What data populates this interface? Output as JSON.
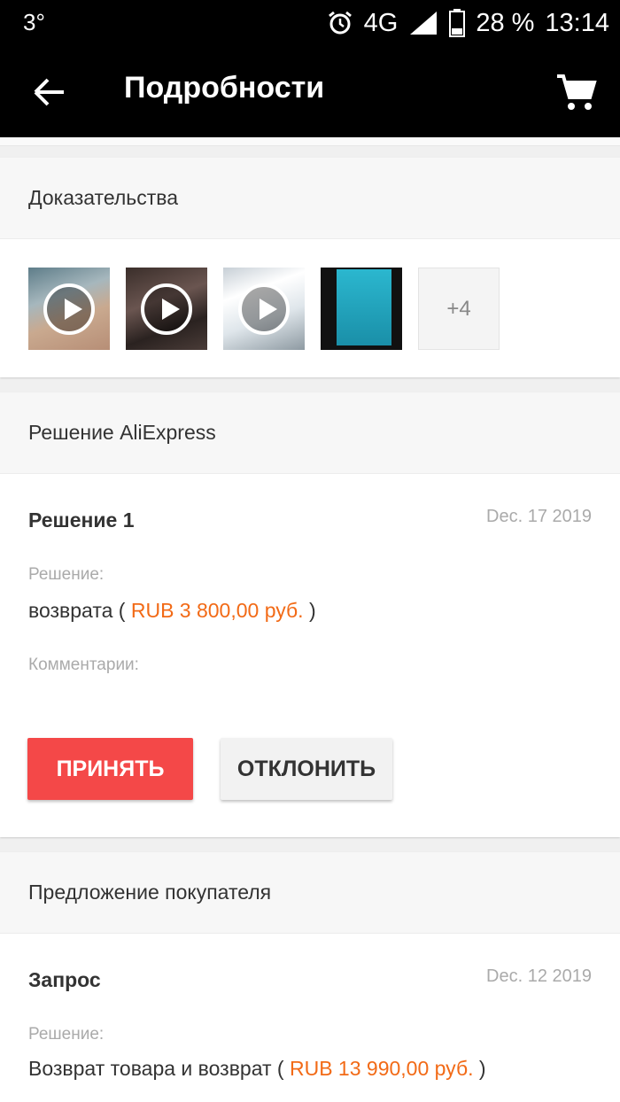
{
  "status_bar": {
    "temperature": "3°",
    "network": "4G",
    "battery": "28 %",
    "time": "13:14"
  },
  "app_bar": {
    "title": "Подробности",
    "back_icon": "arrow-back-icon",
    "cart_icon": "shopping-cart-icon"
  },
  "evidence": {
    "title": "Доказательства",
    "thumbnails": [
      {
        "type": "video"
      },
      {
        "type": "video"
      },
      {
        "type": "video"
      },
      {
        "type": "image"
      }
    ],
    "more_count": "+4"
  },
  "aliexpress_decision": {
    "title": "Решение AliExpress",
    "resolution_title": "Решение 1",
    "date": "Dec. 17 2019",
    "decision_label": "Решение:",
    "decision_prefix": "возврата (",
    "decision_amount": "RUB 3 800,00 руб.",
    "decision_suffix": ")",
    "comments_label": "Комментарии:",
    "accept_label": "ПРИНЯТЬ",
    "decline_label": "ОТКЛОНИТЬ"
  },
  "buyer_offer": {
    "title": "Предложение покупателя",
    "request_title": "Запрос",
    "date": "Dec. 12 2019",
    "decision_label": "Решение:",
    "decision_prefix": "Возврат товара и возврат (",
    "decision_amount": "RUB 13 990,00 руб.",
    "decision_suffix": ")"
  },
  "colors": {
    "accent": "#f44848",
    "amount": "#f26a16"
  }
}
